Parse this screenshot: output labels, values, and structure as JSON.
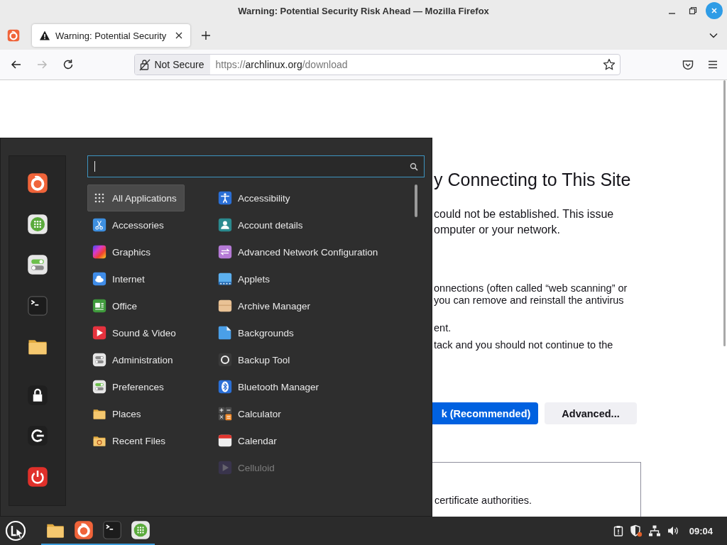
{
  "window": {
    "title": "Warning: Potential Security Risk Ahead — Mozilla Firefox"
  },
  "tabs": [
    {
      "label": "Warning: Potential Security",
      "selected": true
    }
  ],
  "nav_buttons": [
    {
      "kind": "back",
      "disabled": false
    },
    {
      "kind": "forward",
      "disabled": true
    },
    {
      "kind": "reload",
      "disabled": false
    }
  ],
  "address_bar": {
    "security_label": "Not Secure",
    "url_scheme": "https://",
    "url_host": "archlinux.org",
    "url_path": "/download"
  },
  "page": {
    "blocks": [
      {
        "kind": "heading",
        "lines": [
          "y Connecting to This Site"
        ]
      },
      {
        "kind": "lead",
        "lines": [
          "could not be established. This issue",
          "omputer or your network."
        ]
      },
      {
        "kind": "body",
        "lines": [
          "onnections (often called “web scanning” or",
          "you can remove and reinstall the antivirus"
        ]
      },
      {
        "kind": "body",
        "lines": [
          "ent."
        ]
      },
      {
        "kind": "body",
        "lines": [
          "tack and you should not continue to the"
        ]
      }
    ],
    "buttons": [
      {
        "label": "k (Recommended)",
        "primary": true
      },
      {
        "label": "Advanced...",
        "primary": false
      }
    ],
    "details_box": {
      "text": "certificate authorities."
    }
  },
  "menu": {
    "favorites": [
      {
        "kind": "firefox"
      },
      {
        "kind": "software"
      },
      {
        "kind": "settings"
      },
      {
        "kind": "terminal"
      },
      {
        "kind": "folder"
      },
      {
        "kind": "lock"
      },
      {
        "kind": "logout"
      },
      {
        "kind": "power"
      }
    ],
    "categories": [
      {
        "label": "All Applications",
        "kind": "grid",
        "selected": true
      },
      {
        "label": "Accessories",
        "kind": "accessories",
        "selected": false
      },
      {
        "label": "Graphics",
        "kind": "graphics",
        "selected": false
      },
      {
        "label": "Internet",
        "kind": "internet",
        "selected": false
      },
      {
        "label": "Office",
        "kind": "office",
        "selected": false
      },
      {
        "label": "Sound & Video",
        "kind": "sound",
        "selected": false
      },
      {
        "label": "Administration",
        "kind": "admin",
        "selected": false
      },
      {
        "label": "Preferences",
        "kind": "settings",
        "selected": false
      },
      {
        "label": "Places",
        "kind": "folder",
        "selected": false
      },
      {
        "label": "Recent Files",
        "kind": "recent",
        "selected": false
      }
    ],
    "applications": [
      {
        "label": "Accessibility",
        "kind": "accessibility",
        "disabled": false
      },
      {
        "label": "Account details",
        "kind": "account",
        "disabled": false
      },
      {
        "label": "Advanced Network Configuration",
        "kind": "network",
        "disabled": false
      },
      {
        "label": "Applets",
        "kind": "applets",
        "disabled": false
      },
      {
        "label": "Archive Manager",
        "kind": "archive",
        "disabled": false
      },
      {
        "label": "Backgrounds",
        "kind": "backgrounds",
        "disabled": false
      },
      {
        "label": "Backup Tool",
        "kind": "backup",
        "disabled": false
      },
      {
        "label": "Bluetooth Manager",
        "kind": "bluetooth",
        "disabled": false
      },
      {
        "label": "Calculator",
        "kind": "calculator",
        "disabled": false
      },
      {
        "label": "Calendar",
        "kind": "calendar",
        "disabled": false
      },
      {
        "label": "Celluloid",
        "kind": "celluloid",
        "disabled": true
      }
    ]
  },
  "taskbar": {
    "apps": [
      {
        "kind": "folder",
        "running": true
      },
      {
        "kind": "firefox",
        "running": true
      },
      {
        "kind": "terminal",
        "running": true
      },
      {
        "kind": "software",
        "running": true
      }
    ],
    "clock": "09:04"
  }
}
